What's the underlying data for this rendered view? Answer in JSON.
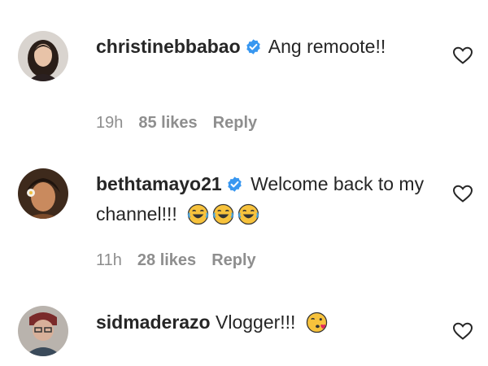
{
  "comments": [
    {
      "username": "christinebbabao",
      "verified": true,
      "text": "Ang remoote!!",
      "time": "19h",
      "likes": "85 likes",
      "reply_label": "Reply"
    },
    {
      "username": "bethtamayo21",
      "verified": true,
      "text": "Welcome back to my channel!!!",
      "emojis": [
        "laughing-tears-emoji",
        "laughing-tears-emoji",
        "laughing-tears-emoji"
      ],
      "time": "11h",
      "likes": "28 likes",
      "reply_label": "Reply"
    },
    {
      "username": "sidmaderazo",
      "verified": false,
      "text": "Vlogger!!!",
      "emojis": [
        "blowing-kiss-emoji"
      ]
    }
  ],
  "colors": {
    "text": "#262626",
    "muted": "#8e8e8e",
    "verified_badge": "#3897f0",
    "emoji_yellow": "#f7c23c",
    "divider": "#dbdbdb"
  },
  "icons": {
    "like": "heart-outline-icon",
    "verified": "verified-badge-icon"
  }
}
